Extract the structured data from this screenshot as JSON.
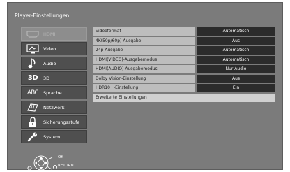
{
  "title": "Player-Einstellungen",
  "sidebar": {
    "items": [
      {
        "label": "HDMI",
        "icon": "hdmi-icon"
      },
      {
        "label": "Video",
        "icon": "video-icon"
      },
      {
        "label": "Audio",
        "icon": "audio-note-icon"
      },
      {
        "label": "3D",
        "icon": "3d-icon",
        "icon_text": "3D"
      },
      {
        "label": "Sprache",
        "icon": "language-abc-icon",
        "icon_text": "ABC"
      },
      {
        "label": "Netzwerk",
        "icon": "network-globe-icon"
      },
      {
        "label": "Sicherungsstufe",
        "icon": "lock-icon"
      },
      {
        "label": "System",
        "icon": "wrench-icon"
      }
    ]
  },
  "settings": {
    "rows": [
      {
        "label": "Videoformat",
        "value": "Automatisch"
      },
      {
        "label": "4K(50p/60p)-Ausgabe",
        "value": "Aus"
      },
      {
        "label": "24p Ausgabe",
        "value": "Automatisch"
      },
      {
        "label": "HDMI(VIDEO)-Ausgabemodus",
        "value": "Automatisch"
      },
      {
        "label": "HDMI(AUDIO)-Ausgabemodus",
        "value": "Nur Audio"
      },
      {
        "label": "Dolby Vision-Einstellung",
        "value": "Aus"
      },
      {
        "label": "HDR10+-Einstellung",
        "value": "Ein"
      }
    ],
    "advanced_label": "Erweiterte Einstellungen"
  },
  "nav_hint": {
    "ok_label": "OK",
    "return_label": "RETURN"
  },
  "colors": {
    "screen_bg": "#7b7b7b",
    "sidebar_item_bg": "#4f4f4f",
    "sidebar_dim_bg": "#8d8d8d",
    "label_cell_bg": "#bdbdbd",
    "value_cell_bg": "#2b2b2b"
  }
}
